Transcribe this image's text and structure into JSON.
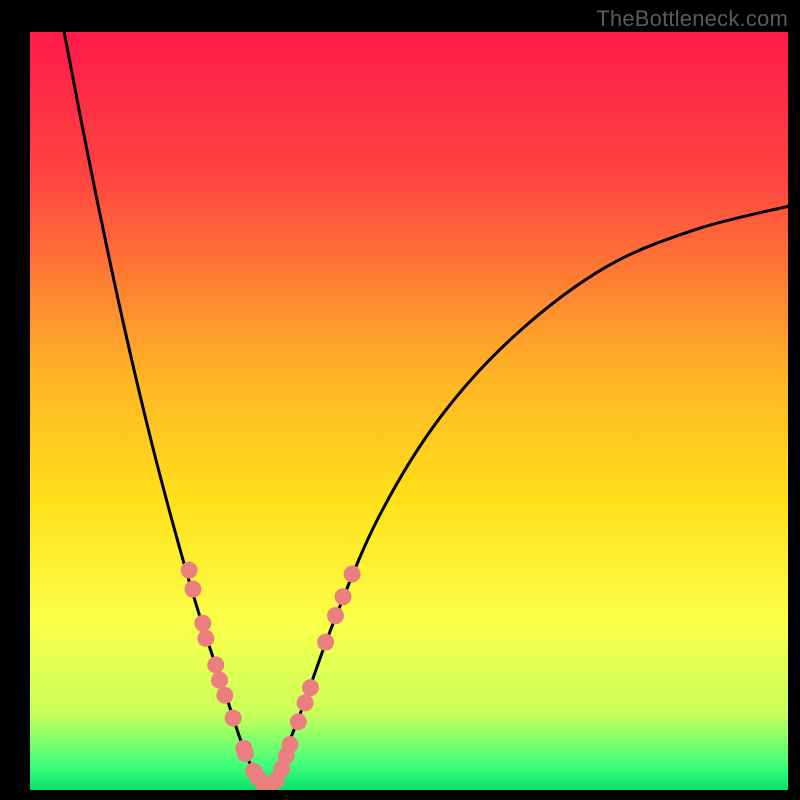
{
  "meta": {
    "watermark": "TheBottleneck.com"
  },
  "chart_data": {
    "type": "line",
    "title": "",
    "xlabel": "",
    "ylabel": "",
    "xlim": [
      0,
      100
    ],
    "ylim": [
      0,
      100
    ],
    "grid": false,
    "legend": "none",
    "description": "Asymmetric V-shaped bottleneck curve; minimum near x≈31 where y≈0. Left branch starts at top-left (x≈4, y≈100) falling steeply; right branch rises from the minimum and asymptotes toward y≈77 at x≈100.",
    "background_gradient": {
      "orientation": "vertical",
      "stops": [
        {
          "offset": 0.0,
          "color": "#ff1a4b"
        },
        {
          "offset": 0.2,
          "color": "#ff4740"
        },
        {
          "offset": 0.45,
          "color": "#ffb326"
        },
        {
          "offset": 0.62,
          "color": "#ffe11a"
        },
        {
          "offset": 0.78,
          "color": "#fbff4a"
        },
        {
          "offset": 0.9,
          "color": "#c8ff5a"
        },
        {
          "offset": 0.965,
          "color": "#45ff7a"
        },
        {
          "offset": 1.0,
          "color": "#00e56a"
        }
      ]
    },
    "series": [
      {
        "name": "curve-left",
        "x": [
          4.5,
          8,
          12,
          16,
          20,
          23,
          26,
          28,
          30,
          31.2
        ],
        "y": [
          100,
          82,
          63,
          46,
          31,
          21,
          12,
          6,
          1.5,
          0.5
        ]
      },
      {
        "name": "curve-right",
        "x": [
          31.2,
          33,
          36,
          40,
          46,
          54,
          64,
          76,
          88,
          100
        ],
        "y": [
          0.5,
          3.5,
          11,
          22,
          36,
          49,
          60,
          69,
          74,
          77
        ]
      }
    ],
    "markers": {
      "name": "data-points",
      "color": "#eb7f7f",
      "points": [
        {
          "x": 21.0,
          "y": 29.0
        },
        {
          "x": 21.5,
          "y": 26.5
        },
        {
          "x": 22.8,
          "y": 22.0
        },
        {
          "x": 23.2,
          "y": 20.0
        },
        {
          "x": 24.5,
          "y": 16.5
        },
        {
          "x": 25.0,
          "y": 14.5
        },
        {
          "x": 25.7,
          "y": 12.5
        },
        {
          "x": 26.8,
          "y": 9.5
        },
        {
          "x": 28.2,
          "y": 5.5
        },
        {
          "x": 28.4,
          "y": 4.8
        },
        {
          "x": 29.5,
          "y": 2.5
        },
        {
          "x": 30.0,
          "y": 1.7
        },
        {
          "x": 30.8,
          "y": 0.8
        },
        {
          "x": 31.6,
          "y": 0.7
        },
        {
          "x": 32.5,
          "y": 1.3
        },
        {
          "x": 33.2,
          "y": 2.8
        },
        {
          "x": 33.8,
          "y": 4.5
        },
        {
          "x": 34.3,
          "y": 6.0
        },
        {
          "x": 35.4,
          "y": 9.0
        },
        {
          "x": 36.3,
          "y": 11.5
        },
        {
          "x": 37.0,
          "y": 13.5
        },
        {
          "x": 39.0,
          "y": 19.5
        },
        {
          "x": 40.3,
          "y": 23.0
        },
        {
          "x": 41.3,
          "y": 25.5
        },
        {
          "x": 42.5,
          "y": 28.5
        }
      ]
    }
  }
}
